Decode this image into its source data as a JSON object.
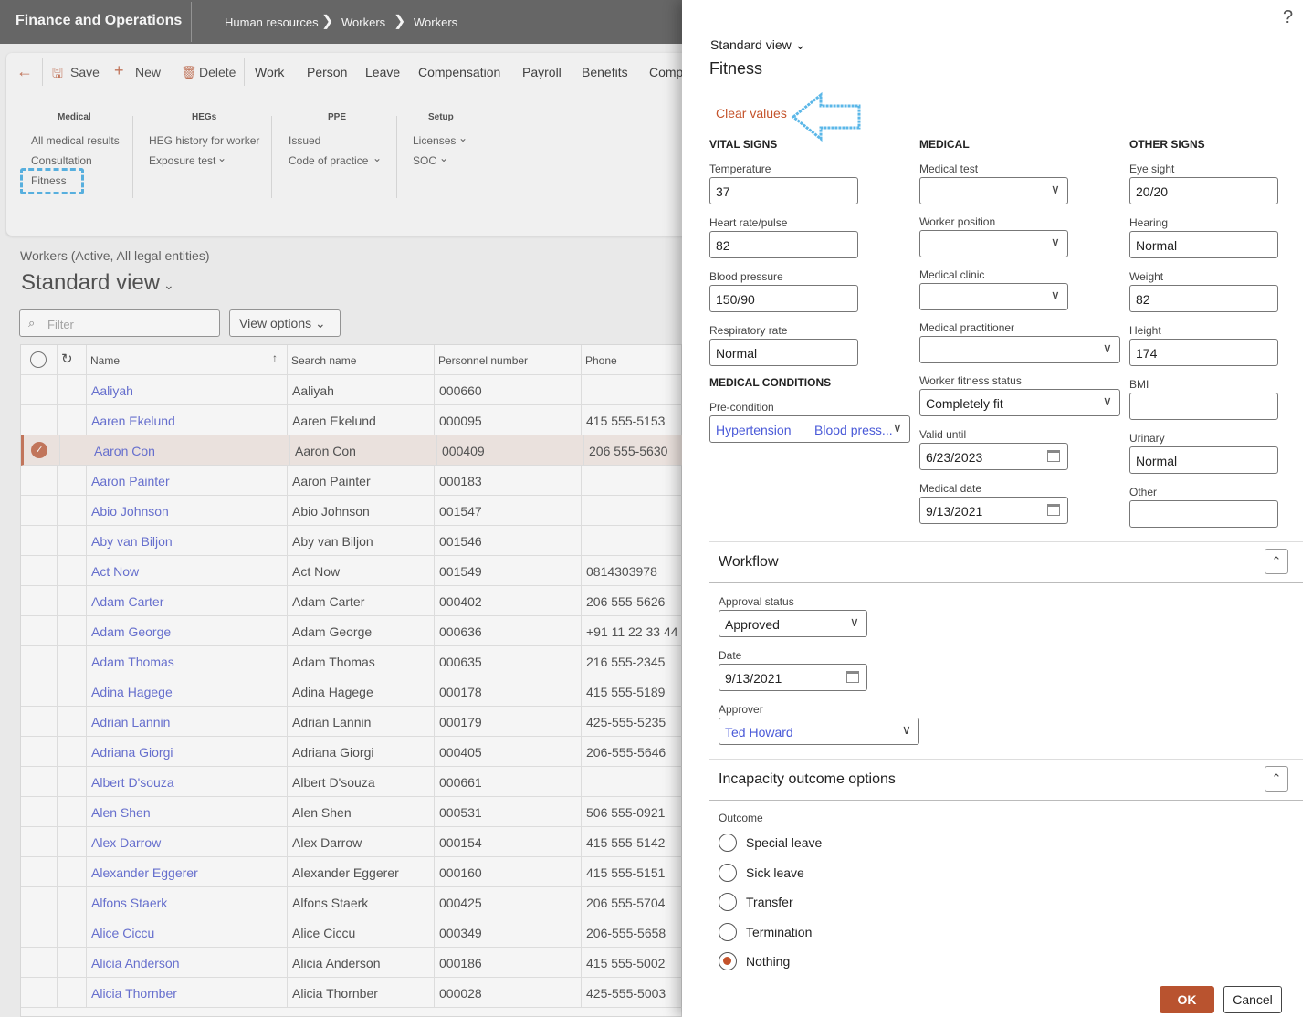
{
  "app": {
    "title": "Finance and Operations",
    "breadcrumb": [
      "Human resources",
      "Workers",
      "Workers"
    ]
  },
  "toolbar": {
    "save": "Save",
    "new": "New",
    "delete": "Delete",
    "tabs": [
      "Work",
      "Person",
      "Leave",
      "Compensation",
      "Payroll",
      "Benefits",
      "Comp"
    ]
  },
  "ribbon": {
    "groups": [
      {
        "title": "Medical",
        "items": [
          "All medical results",
          "Consultation",
          "Fitness"
        ]
      },
      {
        "title": "HEGs",
        "items": [
          "HEG history for worker",
          "Exposure test"
        ]
      },
      {
        "title": "PPE",
        "items": [
          "Issued",
          "Code of practice"
        ]
      },
      {
        "title": "Setup",
        "items": [
          "Licenses",
          "SOC"
        ]
      }
    ]
  },
  "list": {
    "caption": "Workers (Active, All legal entities)",
    "view": "Standard view",
    "filter_placeholder": "Filter",
    "view_options": "View options",
    "columns": [
      "Name",
      "Search name",
      "Personnel number",
      "Phone"
    ],
    "rows": [
      [
        "Aaliyah",
        "Aaliyah",
        "000660",
        ""
      ],
      [
        "Aaren Ekelund",
        "Aaren Ekelund",
        "000095",
        "415 555-5153"
      ],
      [
        "Aaron Con",
        "Aaron Con",
        "000409",
        "206 555-5630"
      ],
      [
        "Aaron Painter",
        "Aaron Painter",
        "000183",
        ""
      ],
      [
        "Abio Johnson",
        "Abio Johnson",
        "001547",
        ""
      ],
      [
        "Aby van Biljon",
        "Aby van Biljon",
        "001546",
        ""
      ],
      [
        "Act Now",
        "Act Now",
        "001549",
        "0814303978"
      ],
      [
        "Adam Carter",
        "Adam Carter",
        "000402",
        "206 555-5626"
      ],
      [
        "Adam George",
        "Adam George",
        "000636",
        "+91 11 22 33 44"
      ],
      [
        "Adam Thomas",
        "Adam Thomas",
        "000635",
        "216 555-2345"
      ],
      [
        "Adina Hagege",
        "Adina Hagege",
        "000178",
        "415 555-5189"
      ],
      [
        "Adrian Lannin",
        "Adrian Lannin",
        "000179",
        "425-555-5235"
      ],
      [
        "Adriana Giorgi",
        "Adriana Giorgi",
        "000405",
        "206-555-5646"
      ],
      [
        "Albert D'souza",
        "Albert D'souza",
        "000661",
        ""
      ],
      [
        "Alen Shen",
        "Alen Shen",
        "000531",
        "506 555-0921"
      ],
      [
        "Alex Darrow",
        "Alex Darrow",
        "000154",
        "415 555-5142"
      ],
      [
        "Alexander Eggerer",
        "Alexander Eggerer",
        "000160",
        "415 555-5151"
      ],
      [
        "Alfons Staerk",
        "Alfons Staerk",
        "000425",
        "206 555-5704"
      ],
      [
        "Alice Ciccu",
        "Alice Ciccu",
        "000349",
        "206-555-5658"
      ],
      [
        "Alicia Anderson",
        "Alicia Anderson",
        "000186",
        "415 555-5002"
      ],
      [
        "Alicia Thornber",
        "Alicia Thornber",
        "000028",
        "425-555-5003"
      ]
    ],
    "selected_row": 2
  },
  "panel": {
    "help": "?",
    "view": "Standard view",
    "title": "Fitness",
    "clear": "Clear values",
    "sections": [
      "VITAL SIGNS",
      "MEDICAL",
      "OTHER SIGNS",
      "MEDICAL CONDITIONS"
    ],
    "fields": [
      {
        "label": "Temperature",
        "value": "37",
        "type": "text"
      },
      {
        "label": "Heart rate/pulse",
        "value": "82",
        "type": "text"
      },
      {
        "label": "Blood pressure",
        "value": "150/90",
        "type": "text"
      },
      {
        "label": "Respiratory rate",
        "value": "Normal",
        "type": "text"
      },
      {
        "label": "Pre-condition",
        "value": "Hypertension",
        "value2": "Blood press...",
        "type": "lookup"
      },
      {
        "label": "Medical test",
        "value": "",
        "type": "select"
      },
      {
        "label": "Worker position",
        "value": "",
        "type": "select"
      },
      {
        "label": "Medical clinic",
        "value": "",
        "type": "select"
      },
      {
        "label": "Medical practitioner",
        "value": "",
        "type": "select"
      },
      {
        "label": "Worker fitness status",
        "value": "Completely fit",
        "type": "select"
      },
      {
        "label": "Valid until",
        "value": "6/23/2023",
        "type": "date"
      },
      {
        "label": "Medical date",
        "value": "9/13/2021",
        "type": "date"
      },
      {
        "label": "Eye sight",
        "value": "20/20",
        "type": "text"
      },
      {
        "label": "Hearing",
        "value": "Normal",
        "type": "text"
      },
      {
        "label": "Weight",
        "value": "82",
        "type": "text"
      },
      {
        "label": "Height",
        "value": "174",
        "type": "text"
      },
      {
        "label": "BMI",
        "value": "",
        "type": "text"
      },
      {
        "label": "Urinary",
        "value": "Normal",
        "type": "text"
      },
      {
        "label": "Other",
        "value": "",
        "type": "text"
      }
    ],
    "workflow": {
      "title": "Workflow",
      "fields": [
        {
          "label": "Approval status",
          "value": "Approved",
          "type": "select"
        },
        {
          "label": "Date",
          "value": "9/13/2021",
          "type": "date"
        },
        {
          "label": "Approver",
          "value": "Ted Howard",
          "type": "lookup"
        }
      ]
    },
    "incapacity": {
      "title": "Incapacity outcome options",
      "outcome_label": "Outcome",
      "options": [
        "Special leave",
        "Sick leave",
        "Transfer",
        "Termination",
        "Nothing"
      ],
      "selected": "Nothing"
    },
    "ok": "OK",
    "cancel": "Cancel"
  },
  "colors": {
    "accent": "#b9532f",
    "link": "#6b74d6",
    "highlight": "#5bb7e8"
  }
}
